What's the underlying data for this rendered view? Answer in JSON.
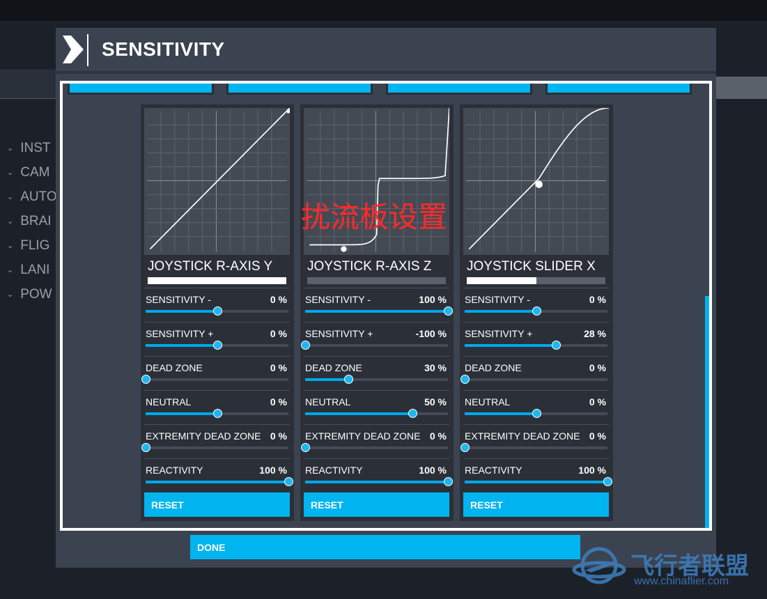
{
  "dialog": {
    "title": "SENSITIVITY",
    "done_label": "DONE"
  },
  "sidebar": {
    "items": [
      {
        "label": "INST"
      },
      {
        "label": "CAM"
      },
      {
        "label": "AUTO"
      },
      {
        "label": "BRAI"
      },
      {
        "label": "FLIG"
      },
      {
        "label": "LANI"
      },
      {
        "label": "POW"
      }
    ]
  },
  "accent": "#00b4f0",
  "overlay_text": "扰流板设置",
  "watermark": {
    "name": "飞行者联盟",
    "url": "www.chinaflier.com"
  },
  "cards": [
    {
      "title": "JOYSTICK R-AXIS Y",
      "axis_fill": 1.0,
      "curve": "linear",
      "reset": "RESET",
      "rows": [
        {
          "label": "SENSITIVITY -",
          "value": "0 %",
          "fill": 0.5
        },
        {
          "label": "SENSITIVITY +",
          "value": "0 %",
          "fill": 0.5
        },
        {
          "label": "DEAD ZONE",
          "value": "0 %",
          "fill": 0
        },
        {
          "label": "NEUTRAL",
          "value": "0 %",
          "fill": 0.5
        },
        {
          "label": "EXTREMITY DEAD ZONE",
          "value": "0 %",
          "fill": 0
        },
        {
          "label": "REACTIVITY",
          "value": "100 %",
          "fill": 1
        }
      ]
    },
    {
      "title": "JOYSTICK R-AXIS Z",
      "axis_fill": 0,
      "curve": "step",
      "reset": "RESET",
      "rows": [
        {
          "label": "SENSITIVITY -",
          "value": "100 %",
          "fill": 1
        },
        {
          "label": "SENSITIVITY +",
          "value": "-100 %",
          "fill": 0
        },
        {
          "label": "DEAD ZONE",
          "value": "30 %",
          "fill": 0.3
        },
        {
          "label": "NEUTRAL",
          "value": "50 %",
          "fill": 0.75
        },
        {
          "label": "EXTREMITY DEAD ZONE",
          "value": "0 %",
          "fill": 0
        },
        {
          "label": "REACTIVITY",
          "value": "100 %",
          "fill": 1
        }
      ]
    },
    {
      "title": "JOYSTICK SLIDER X",
      "axis_fill": 0.5,
      "curve": "scurve",
      "reset": "RESET",
      "rows": [
        {
          "label": "SENSITIVITY -",
          "value": "0 %",
          "fill": 0.5
        },
        {
          "label": "SENSITIVITY +",
          "value": "28 %",
          "fill": 0.64
        },
        {
          "label": "DEAD ZONE",
          "value": "0 %",
          "fill": 0
        },
        {
          "label": "NEUTRAL",
          "value": "0 %",
          "fill": 0.5
        },
        {
          "label": "EXTREMITY DEAD ZONE",
          "value": "0 %",
          "fill": 0
        },
        {
          "label": "REACTIVITY",
          "value": "100 %",
          "fill": 1
        }
      ]
    }
  ]
}
